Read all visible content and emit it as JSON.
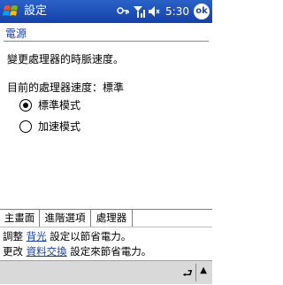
{
  "window": {
    "title": "設定",
    "time": "5:30",
    "ok_label": "ok"
  },
  "page": {
    "section_title": "電源",
    "description": "變更處理器的時脈速度。",
    "speed_label": "目前的處理器速度：",
    "speed_value": "標準",
    "options": [
      {
        "label": "標準模式",
        "selected": true
      },
      {
        "label": "加速模式",
        "selected": false
      }
    ]
  },
  "tabs": [
    {
      "label": "主畫面",
      "active": false
    },
    {
      "label": "進階選項",
      "active": false
    },
    {
      "label": "處理器",
      "active": true
    }
  ],
  "footer": {
    "line1_prefix": "調整 ",
    "line1_link": "背光",
    "line1_suffix": " 設定以節省電力。",
    "line2_prefix": "更改 ",
    "line2_link": "資料交換",
    "line2_suffix": " 設定來節省電力。"
  }
}
